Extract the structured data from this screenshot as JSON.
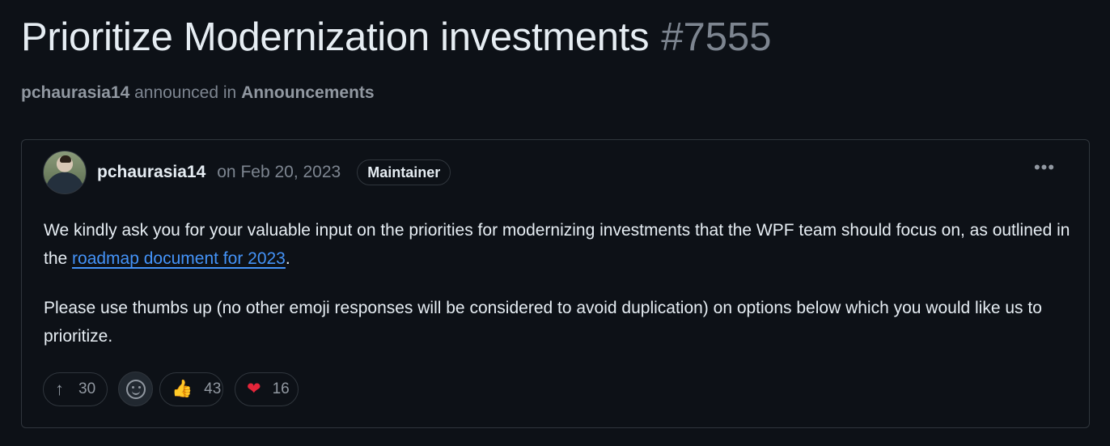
{
  "discussion": {
    "title": "Prioritize Modernization investments",
    "number": "#7555",
    "author": "pchaurasia14",
    "announced_text": "announced in",
    "category": "Announcements"
  },
  "post": {
    "author": "pchaurasia14",
    "date": "on Feb 20, 2023",
    "badge": "Maintainer",
    "more_label": "•••",
    "paragraph1_before": "We kindly ask you for your valuable input on the priorities for modernizing investments that the WPF team should focus on, as outlined in the ",
    "link_text": "roadmap document for 2023",
    "paragraph1_after": ".",
    "paragraph2": "Please use thumbs up (no other emoji responses will be considered to avoid duplication) on options below which you would like us to prioritize."
  },
  "reactions": {
    "upvote_count": "30",
    "thumbs_up_count": "43",
    "heart_count": "16",
    "upvote_icon": "arrow-up-icon",
    "emoji_icon": "smiley-icon",
    "thumbs_icon": "thumbs-up-emoji",
    "heart_icon": "heart-emoji"
  },
  "colors": {
    "background": "#0d1117",
    "text": "#e6edf3",
    "muted": "#7d8590",
    "link": "#4493f8",
    "border": "#30363d",
    "heart": "#e5253a"
  }
}
